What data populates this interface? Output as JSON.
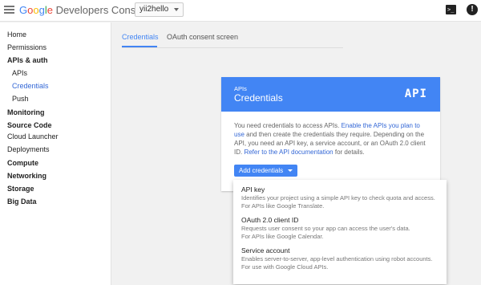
{
  "header": {
    "logo_letters": [
      "G",
      "o",
      "o",
      "g",
      "l",
      "e"
    ],
    "logo_rest": " Developers Console",
    "project": "yii2hello",
    "icons": [
      "menu-icon",
      "cloud-shell-icon",
      "feedback-icon"
    ],
    "term_glyph": ">_",
    "feedback_glyph": "!"
  },
  "sidebar": {
    "items": [
      {
        "label": "Home"
      },
      {
        "label": "Permissions"
      },
      {
        "label": "APIs & auth"
      },
      {
        "label": "APIs"
      },
      {
        "label": "Credentials"
      },
      {
        "label": "Push"
      },
      {
        "label": "Monitoring"
      },
      {
        "label": "Source Code"
      },
      {
        "label": "Cloud Launcher"
      },
      {
        "label": "Deployments"
      },
      {
        "label": "Compute"
      },
      {
        "label": "Networking"
      },
      {
        "label": "Storage"
      },
      {
        "label": "Big Data"
      }
    ]
  },
  "tabs": [
    {
      "label": "Credentials"
    },
    {
      "label": "OAuth consent screen"
    }
  ],
  "card": {
    "kicker": "APIs",
    "title": "Credentials",
    "glyph": "API",
    "body_1": "You need credentials to access APIs. ",
    "link_1": "Enable the APIs you plan to use",
    "body_2": " and then create the credentials they require. Depending on the API, you need an API key, a service account, or an OAuth 2.0 client ID. ",
    "link_2": "Refer to the API documentation",
    "body_3": " for details.",
    "button": "Add credentials"
  },
  "dropdown": {
    "items": [
      {
        "title": "API key",
        "desc_1": "Identifies your project using a simple API key to check quota and access.",
        "desc_2": "For APIs like Google Translate."
      },
      {
        "title": "OAuth 2.0 client ID",
        "desc_1": "Requests user consent so your app can access the user's data.",
        "desc_2": "For APIs like Google Calendar."
      },
      {
        "title": "Service account",
        "desc_1": "Enables server-to-server, app-level authentication using robot accounts.",
        "desc_2": "For use with Google Cloud APIs."
      }
    ]
  },
  "colors": {
    "accent": "#4285f4",
    "link": "#3367d6"
  }
}
